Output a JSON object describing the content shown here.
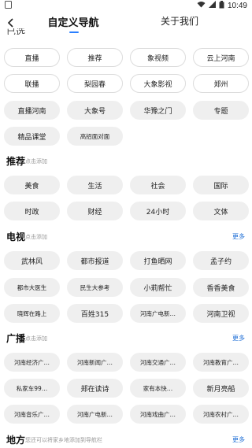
{
  "status": {
    "time": "10:49"
  },
  "header": {
    "tab_custom": "自定义导航",
    "tab_about": "关于我们"
  },
  "my_section": {
    "title": "已选",
    "chips": [
      "直播",
      "推荐",
      "象视频",
      "云上河南",
      "联播",
      "梨园春",
      "大象影视",
      "郑州",
      "直播河南",
      "大象号",
      "华豫之门",
      "专题",
      "精品课堂",
      "高招面对面"
    ]
  },
  "recommend": {
    "title": "推荐",
    "hint": "点击添加",
    "chips": [
      "美食",
      "生活",
      "社会",
      "国际",
      "时政",
      "财经",
      "24小时",
      "文体"
    ]
  },
  "tv": {
    "title": "电视",
    "hint": "点击添加",
    "more": "更多",
    "chips": [
      "武林风",
      "都市报道",
      "打鱼晒网",
      "孟子约",
      "都市大医生",
      "民生大参考",
      "小莉帮忙",
      "香香美食",
      "晓辉在路上",
      "百姓315",
      "河南广电新…",
      "河南卫视"
    ]
  },
  "radio": {
    "title": "广播",
    "hint": "点击添加",
    "more": "更多",
    "chips": [
      "河南经济广…",
      "河南新闻广…",
      "河南交通广…",
      "河南教育广…",
      "私家车99…",
      "郑在读诗",
      "家有本快…",
      "新月亮船",
      "河南音乐广…",
      "河南广电新…",
      "河南戏曲广…",
      "河南农村广…"
    ]
  },
  "local": {
    "title": "地方",
    "hint": "您还可以将家乡地添加到导航栏",
    "more": "更多"
  }
}
